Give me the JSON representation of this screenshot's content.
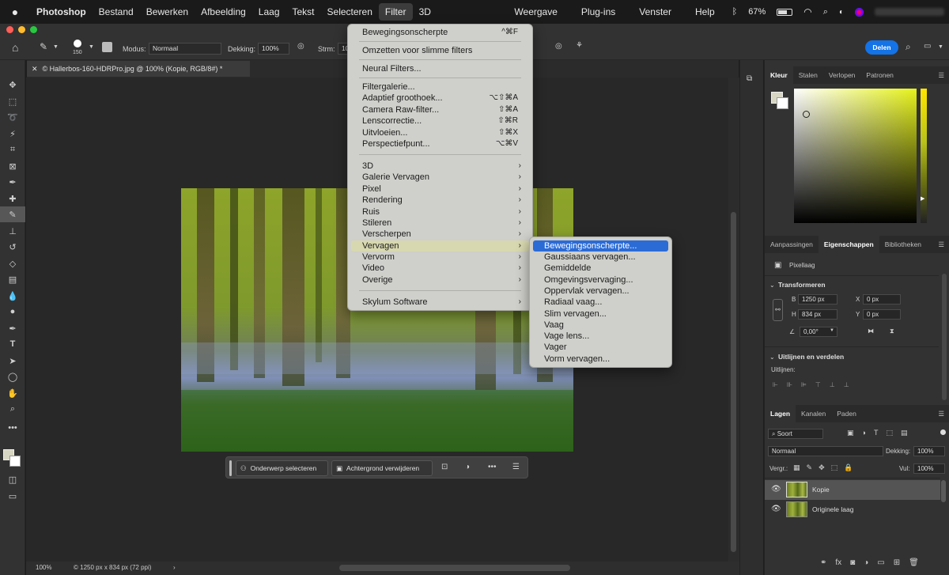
{
  "menubar": {
    "app": "Photoshop",
    "items": [
      "Bestand",
      "Bewerken",
      "Afbeelding",
      "Laag",
      "Tekst",
      "Selecteren",
      "Filter",
      "3D"
    ],
    "right_items": [
      "Weergave",
      "Plug-ins",
      "Venster",
      "Help"
    ],
    "battery": "67%"
  },
  "options": {
    "brush_size": "150",
    "mode_label": "Modus:",
    "mode_value": "Normaal",
    "opacity_label": "Dekking:",
    "opacity_value": "100%",
    "flow_label": "Strm:",
    "flow_value": "10",
    "share": "Delen"
  },
  "document": {
    "tab_title": "© Hallerbos-160-HDRPro.jpg @ 100% (Kopie, RGB/8#) *",
    "zoom": "100%",
    "info": "1250 px x 834 px (72 ppi)"
  },
  "context_bar": {
    "select_subject": "Onderwerp selecteren",
    "remove_bg": "Achtergrond verwijderen"
  },
  "filter_menu": {
    "items": [
      {
        "label": "Bewegingsonscherpte",
        "shortcut": "^⌘F"
      },
      {
        "label": "Omzetten voor slimme filters"
      },
      {
        "label": "Neural Filters..."
      },
      {
        "label": "Filtergalerie..."
      },
      {
        "label": "Adaptief groothoek...",
        "shortcut": "⌥⇧⌘A"
      },
      {
        "label": "Camera Raw-filter...",
        "shortcut": "⇧⌘A"
      },
      {
        "label": "Lenscorrectie...",
        "shortcut": "⇧⌘R"
      },
      {
        "label": "Uitvloeien...",
        "shortcut": "⇧⌘X"
      },
      {
        "label": "Perspectiefpunt...",
        "shortcut": "⌥⌘V"
      },
      {
        "label": "3D"
      },
      {
        "label": "Galerie Vervagen"
      },
      {
        "label": "Pixel"
      },
      {
        "label": "Rendering"
      },
      {
        "label": "Ruis"
      },
      {
        "label": "Stileren"
      },
      {
        "label": "Verscherpen"
      },
      {
        "label": "Vervagen"
      },
      {
        "label": "Vervorm"
      },
      {
        "label": "Video"
      },
      {
        "label": "Overige"
      },
      {
        "label": "Skylum Software"
      }
    ]
  },
  "blur_submenu": {
    "items": [
      "Bewegingsonscherpte...",
      "Gaussiaans vervagen...",
      "Gemiddelde",
      "Omgevingsvervaging...",
      "Oppervlak vervagen...",
      "Radiaal vaag...",
      "Slim vervagen...",
      "Vaag",
      "Vage lens...",
      "Vager",
      "Vorm vervagen..."
    ]
  },
  "color_panel": {
    "tabs": [
      "Kleur",
      "Stalen",
      "Verlopen",
      "Patronen"
    ]
  },
  "properties_panel": {
    "tabs": [
      "Aanpassingen",
      "Eigenschappen",
      "Bibliotheken"
    ],
    "layer_type": "Pixellaag",
    "transform_title": "Transformeren",
    "w_label": "B",
    "w_value": "1250 px",
    "h_label": "H",
    "h_value": "834 px",
    "x_label": "X",
    "x_value": "0 px",
    "y_label": "Y",
    "y_value": "0 px",
    "angle": "0,00°",
    "align_title": "Uitlijnen en verdelen",
    "align_label": "Uitlijnen:"
  },
  "layers_panel": {
    "tabs": [
      "Lagen",
      "Kanalen",
      "Paden"
    ],
    "filter_kind": "Soort",
    "blend_mode": "Normaal",
    "opacity_label": "Dekking:",
    "opacity_value": "100%",
    "lock_label": "Vergr.:",
    "fill_label": "Vul:",
    "fill_value": "100%",
    "layers": [
      {
        "name": "Kopie",
        "selected": true
      },
      {
        "name": "Originele laag",
        "selected": false
      }
    ]
  }
}
